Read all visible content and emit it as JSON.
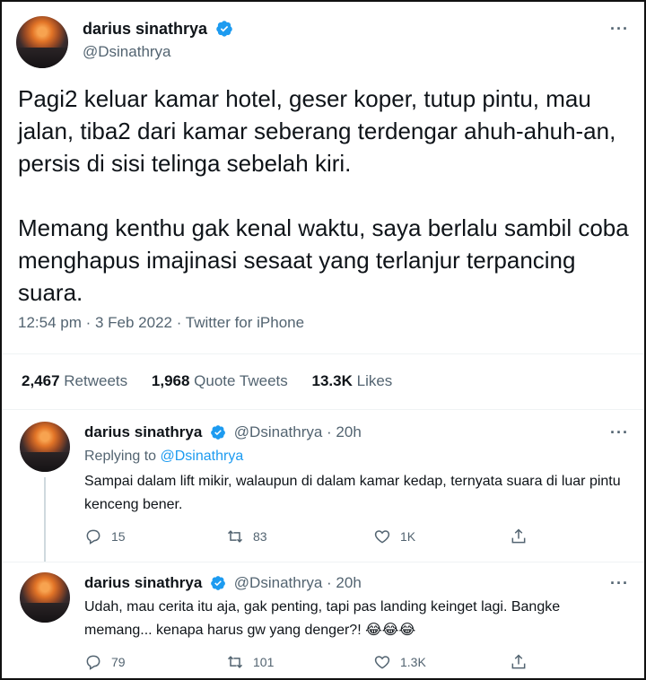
{
  "main_tweet": {
    "author_name": "darius sinathrya",
    "handle": "@Dsinathrya",
    "paragraphs": [
      "Pagi2 keluar kamar hotel, geser koper, tutup pintu, mau jalan, tiba2 dari kamar seberang terdengar ahuh-ahuh-an, persis di sisi telinga sebelah kiri.",
      "Memang kenthu gak kenal waktu, saya berlalu sambil coba menghapus imajinasi sesaat yang terlanjur terpancing suara."
    ],
    "meta": "12:54 pm · 3 Feb 2022 · Twitter for iPhone",
    "stats": {
      "retweets_count": "2,467",
      "retweets_label": "Retweets",
      "quotes_count": "1,968",
      "quotes_label": "Quote Tweets",
      "likes_count": "13.3K",
      "likes_label": "Likes"
    }
  },
  "replies": [
    {
      "author_name": "darius sinathrya",
      "handle_time": "@Dsinathrya · 20h",
      "replying_prefix": "Replying to",
      "replying_to": "@Dsinathrya",
      "text": "Sampai dalam lift mikir, walaupun di dalam kamar kedap, ternyata suara di luar pintu kenceng bener.",
      "replies": "15",
      "retweets": "83",
      "likes": "1K"
    },
    {
      "author_name": "darius sinathrya",
      "handle_time": "@Dsinathrya · 20h",
      "text": "Udah, mau cerita itu aja, gak penting, tapi pas landing keinget lagi. Bangke memang... kenapa harus gw yang denger?! 😂😂😂",
      "replies": "79",
      "retweets": "101",
      "likes": "1.3K"
    }
  ],
  "colors": {
    "text": "#0f1419",
    "secondary": "#536471",
    "accent": "#1d9bf0",
    "divider": "#eff3f4"
  },
  "icons": [
    "verified-icon",
    "more-icon",
    "reply-icon",
    "retweet-icon",
    "like-icon",
    "share-icon"
  ]
}
